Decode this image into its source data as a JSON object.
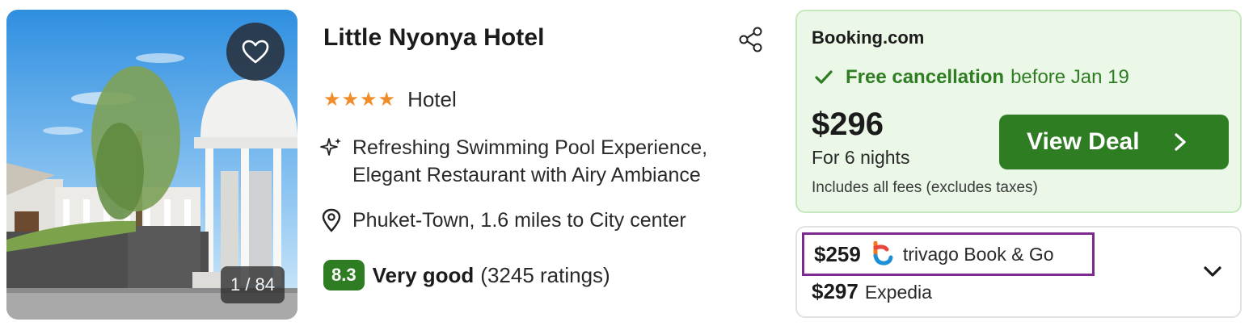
{
  "hotel": {
    "name": "Little Nyonya Hotel",
    "stars": "★★★★",
    "type": "Hotel",
    "feature_line_1": "Refreshing Swimming Pool Experience,",
    "feature_line_2": "Elegant Restaurant with Airy Ambiance",
    "location": "Phuket-Town, 1.6 miles to City center",
    "rating_score": "8.3",
    "rating_label": "Very good",
    "rating_count": "(3245 ratings)",
    "photo_counter": "1 / 84"
  },
  "deal": {
    "provider": "Booking.com",
    "cancellation_strong": "Free cancellation",
    "cancellation_rest": "before Jan 19",
    "price": "$296",
    "nights": "For 6 nights",
    "fees": "Includes all fees (excludes taxes)",
    "button_label": "View Deal"
  },
  "offers": [
    {
      "price": "$259",
      "name": "trivago Book & Go"
    },
    {
      "price": "$297",
      "name": "Expedia"
    }
  ],
  "icons": {
    "favorite": "heart-icon",
    "share": "share-icon",
    "feature": "sparkle-icon",
    "location": "map-pin-icon",
    "check": "check-icon",
    "expand": "chevron-down-icon"
  },
  "colors": {
    "deal_green": "#2f7d23",
    "deal_bg": "#ebf8e7",
    "star_orange": "#f28c28",
    "highlight_purple": "#7d2a90"
  }
}
